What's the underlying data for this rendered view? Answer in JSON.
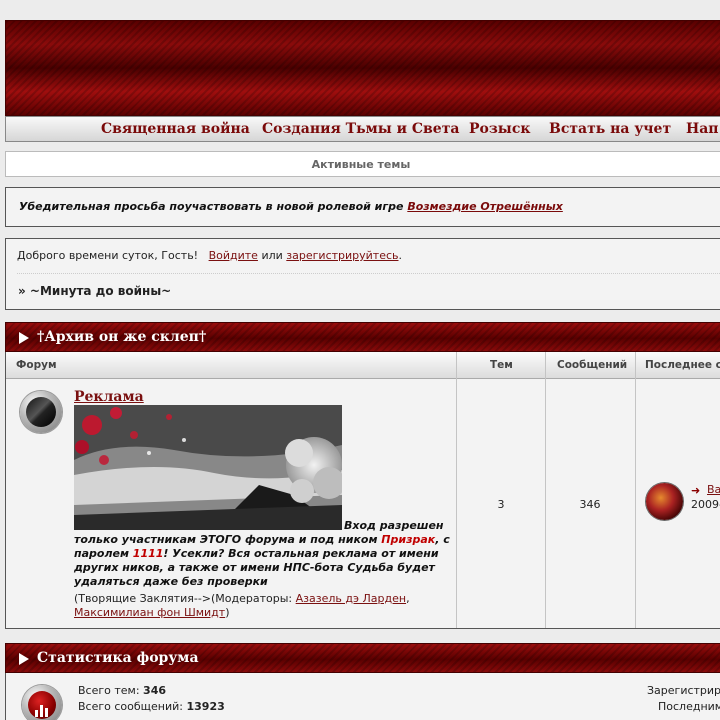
{
  "nav": {
    "items": [
      "Священная война",
      "Создания Тьмы и Света",
      "Розыск",
      "Встать на учет",
      "Нап"
    ]
  },
  "active_topics": "Активные темы",
  "announcement": {
    "text": "Убедительная просьба поучаствовать в новой ролевой игре ",
    "link": "Возмездие Отрешённых"
  },
  "welcome": {
    "greeting": "Доброго времени суток, Гость!",
    "login": "Войдите",
    "or": "или",
    "register": "зарегистрируйтесь",
    "period": ".",
    "crumbs": "» ~Минута до войны~"
  },
  "category": {
    "title": "†Архив он же склеп†",
    "columns": {
      "forum": "Форум",
      "topics": "Тем",
      "posts": "Сообщений",
      "last": "Последнее со"
    }
  },
  "forum": {
    "name": "Реклама",
    "desc_1": "Вход разрешен только участникам ЭТОГО форума и под ником ",
    "nick": "Призрак",
    "desc_2": ", с паролем ",
    "password": "1111",
    "desc_3": "! Усекли? Вся остальная реклама от имени других ников, а также от имени НПС-бота Судьба будет удаляться даже без проверки",
    "mods_prefix": "(Творящие Заклятия-->(Модераторы: ",
    "mod_1": "Азазель дэ Ларден",
    "mods_sep": ",",
    "mod_2": "Максимилиан фон Шмидт",
    "mods_suffix": ")",
    "topics": "3",
    "posts": "346",
    "last_post_link": "Ва",
    "last_post_date": "2009-"
  },
  "stats": {
    "title": "Статистика форума",
    "topics_label": "Всего тем: ",
    "topics_value": "346",
    "posts_label": "Всего сообщений: ",
    "posts_value": "13923",
    "right_1": "Зарегистрир",
    "right_2": "Последним"
  },
  "colors": {
    "brand_red": "#7a0a0a",
    "header_dark": "#5a0000"
  }
}
